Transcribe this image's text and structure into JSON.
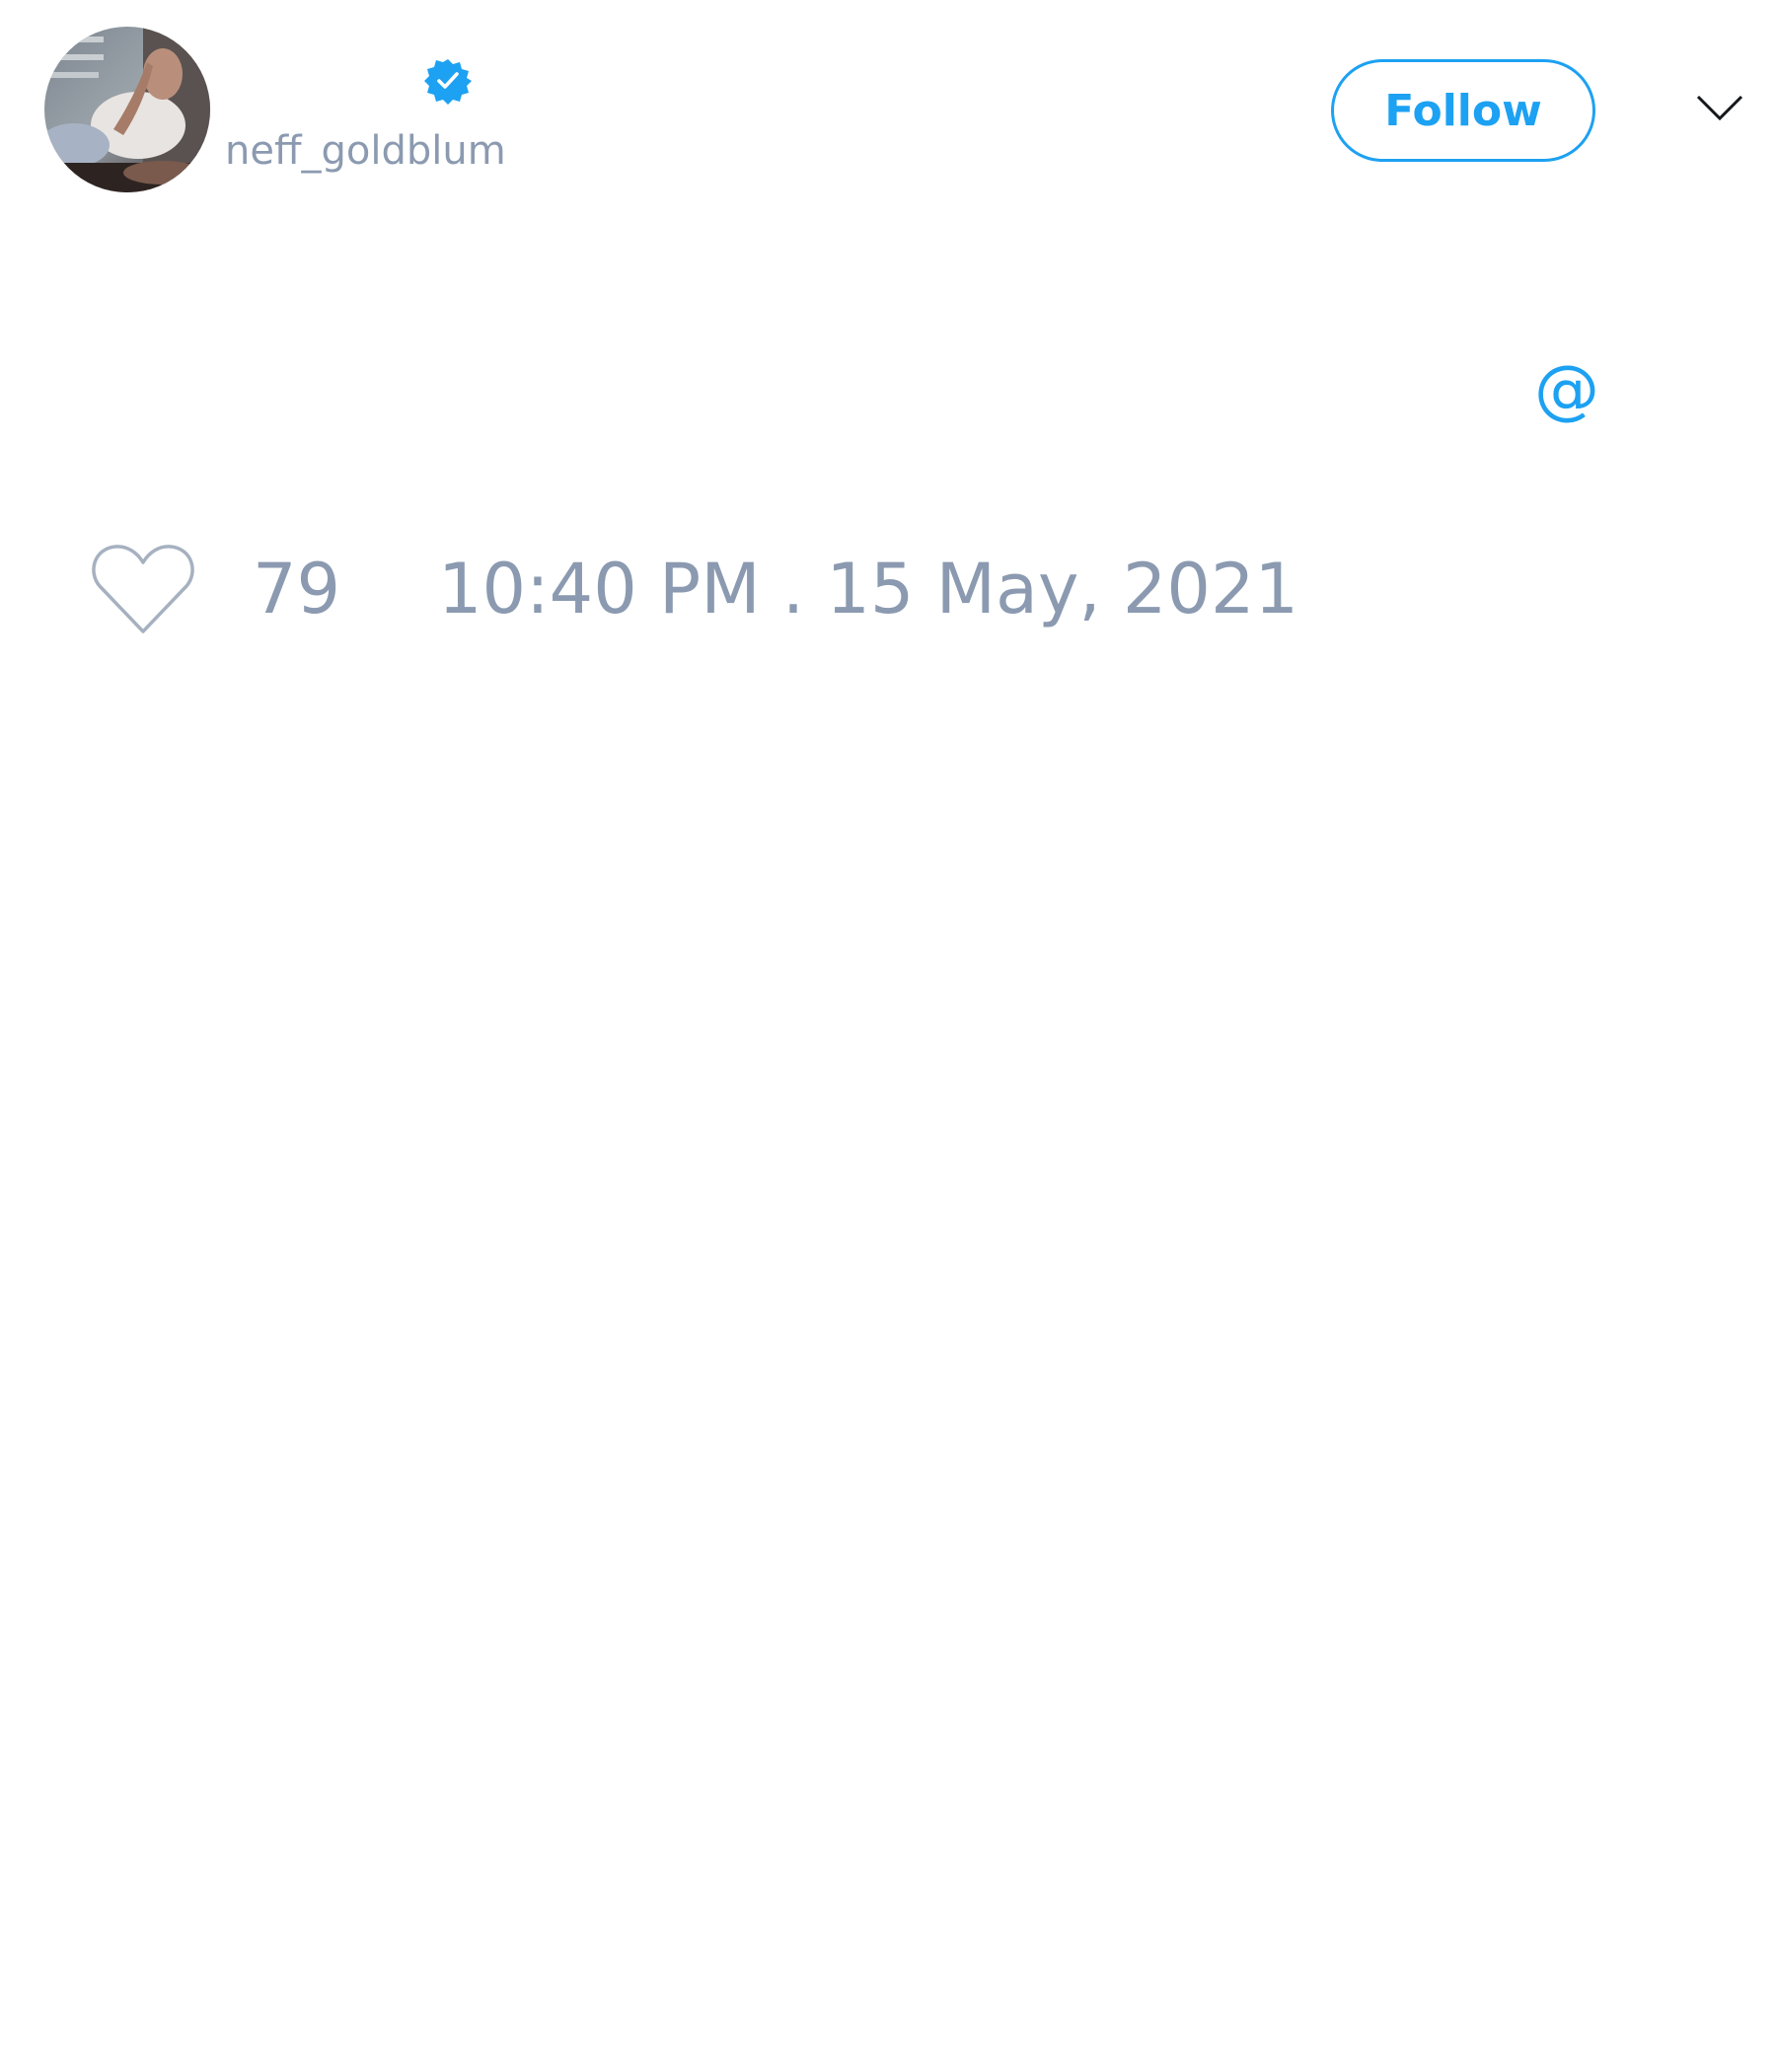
{
  "tweet": {
    "author": {
      "display_name": "",
      "handle": "neff_goldblum",
      "verified": true,
      "avatar": "profile-photo"
    },
    "follow_label": "Follow",
    "menu_icon": "chevron-down-icon",
    "text": "",
    "mention_symbol": "@",
    "likes": "79",
    "timestamp": "10:40 PM . 15 May, 2021",
    "colors": {
      "accent": "#1da1f2",
      "muted": "#8b9ab0",
      "icon_muted": "#a6b1c0",
      "background": "#ffffff"
    }
  }
}
